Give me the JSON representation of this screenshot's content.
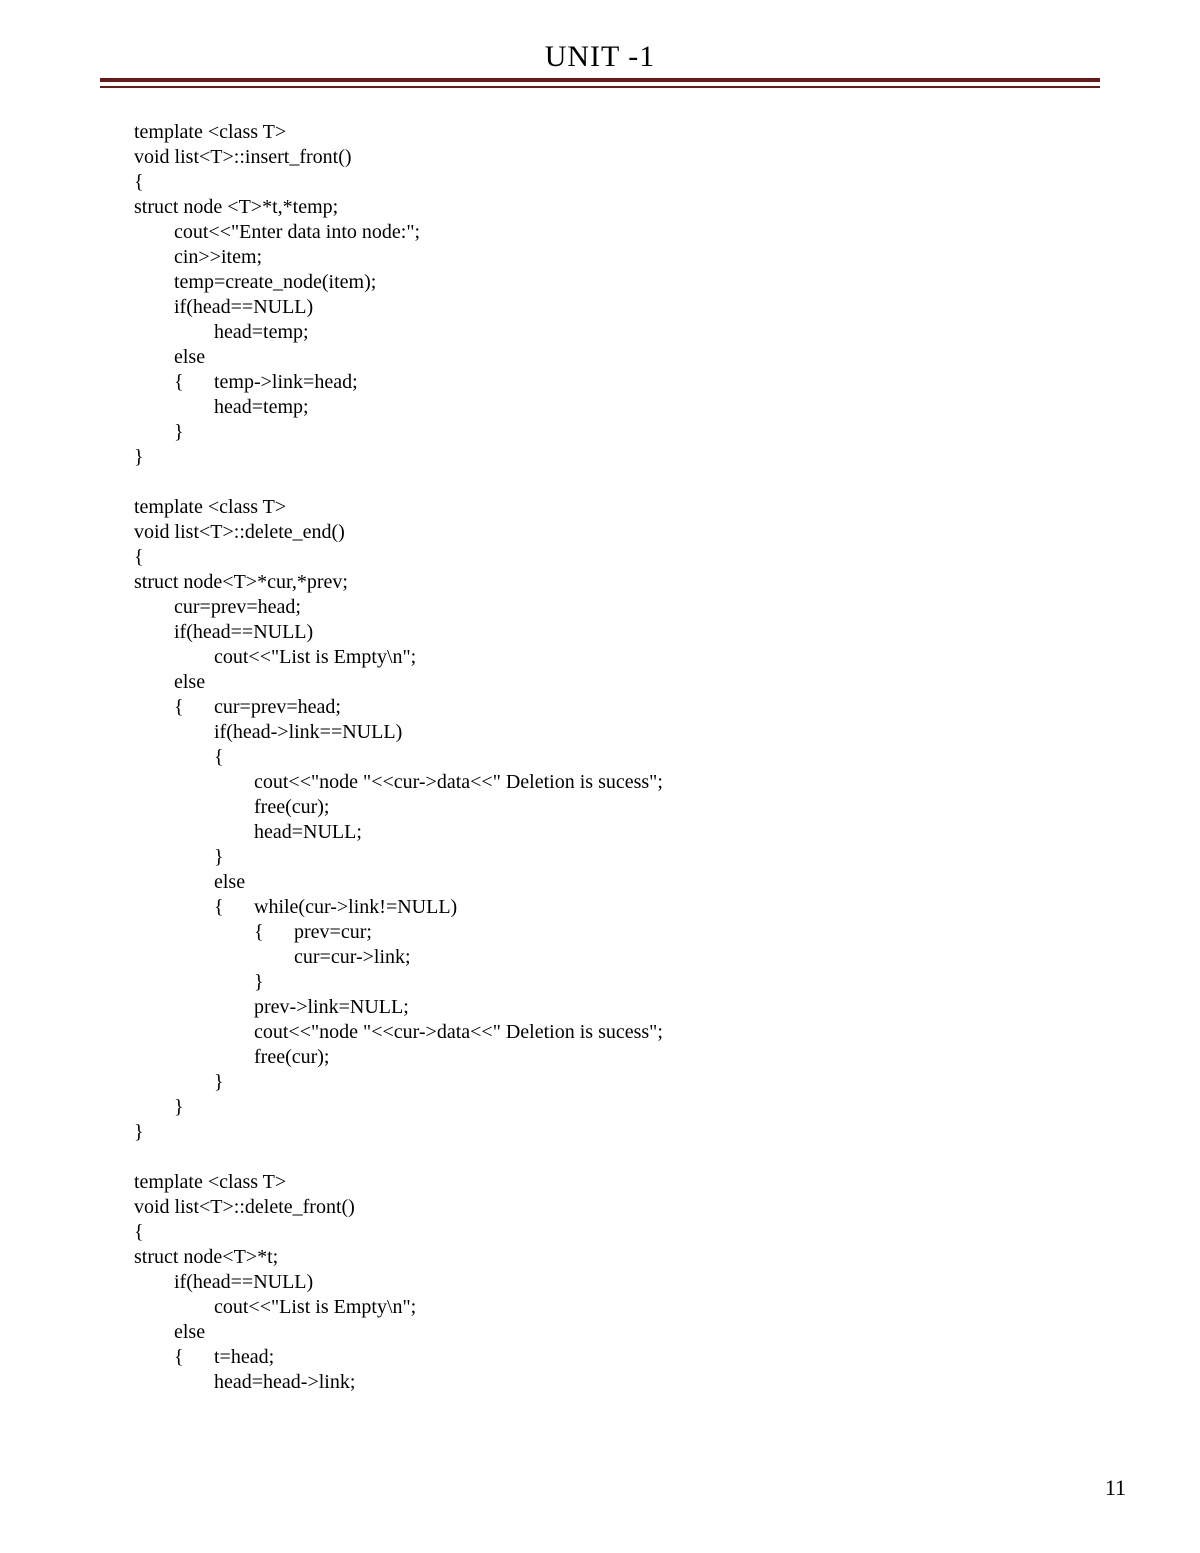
{
  "header": {
    "title": "UNIT -1"
  },
  "code": {
    "text": "template <class T>\nvoid list<T>::insert_front()\n{\nstruct node <T>*t,*temp;\n\tcout<<\"Enter data into node:\";\n\tcin>>item;\n\ttemp=create_node(item);\n\tif(head==NULL)\n\t\thead=temp;\n\telse\n\t{\ttemp->link=head;\n\t\thead=temp;\n\t}\n}\n\ntemplate <class T>\nvoid list<T>::delete_end()\n{\nstruct node<T>*cur,*prev;\n\tcur=prev=head;\n\tif(head==NULL)\n\t\tcout<<\"List is Empty\\n\";\n\telse\n\t{\tcur=prev=head;\n\t\tif(head->link==NULL)\n\t\t{\n\t\t\tcout<<\"node \"<<cur->data<<\" Deletion is sucess\";\n\t\t\tfree(cur);\n\t\t\thead=NULL;\n\t\t}\n\t\telse\n\t\t{\twhile(cur->link!=NULL)\n\t\t\t{\tprev=cur;\n\t\t\t\tcur=cur->link;\n\t\t\t}\n\t\t\tprev->link=NULL;\n\t\t\tcout<<\"node \"<<cur->data<<\" Deletion is sucess\";\n\t\t\tfree(cur);\n\t\t}\n\t}\n}\n\ntemplate <class T>\nvoid list<T>::delete_front()\n{\nstruct node<T>*t;\n\tif(head==NULL)\n\t\tcout<<\"List is Empty\\n\";\n\telse\n\t{\tt=head;\n\t\thead=head->link;"
  },
  "footer": {
    "page_number": "11"
  }
}
